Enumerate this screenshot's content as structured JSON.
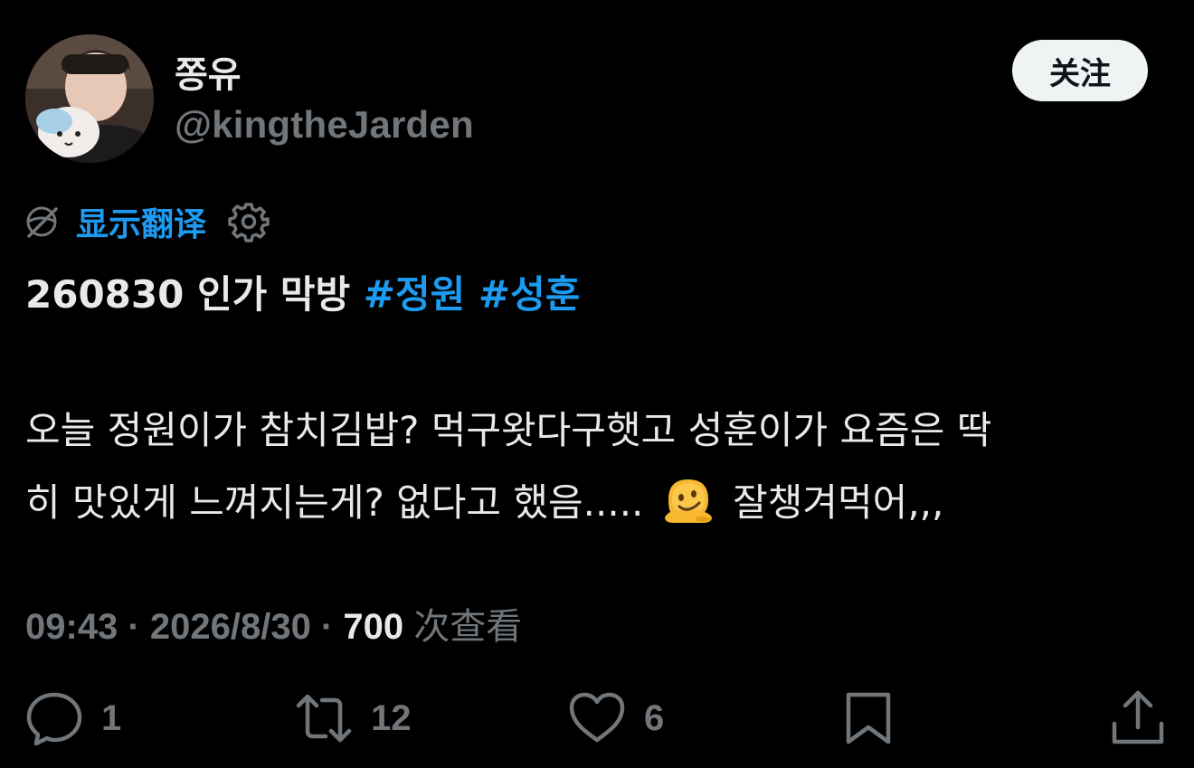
{
  "author": {
    "display_name": "쫑유",
    "handle": "@kingtheJarden"
  },
  "follow_button": {
    "label": "关注"
  },
  "translate": {
    "label": "显示翻译"
  },
  "tweet": {
    "line1_text": "260830 인가 막방 ",
    "hashtags": [
      "#정원",
      "#성훈"
    ],
    "body_line1": "오늘 정원이가 참치김밥? 먹구왓다구햇고 성훈이가 요즘은 딱",
    "body_line2_before_emoji": "히 맛있게 느껴지는게? 없다고 했음..... ",
    "body_line2_after_emoji": " 잘챙겨먹어,,,"
  },
  "meta": {
    "time": "09:43",
    "separator": " · ",
    "date": "2026/8/30",
    "views_count": "700",
    "views_label": "次查看"
  },
  "actions": {
    "reply_count": "1",
    "retweet_count": "12",
    "like_count": "6"
  },
  "colors": {
    "background": "#000000",
    "text_primary": "#e7e9ea",
    "text_secondary": "#71767b",
    "accent": "#1d9bf0",
    "follow_button_bg": "#eff3f4"
  },
  "icons": {
    "translate": "globe-slash-icon",
    "settings": "gear-icon",
    "emoji": "melting-face-emoji",
    "reply": "speech-bubble-icon",
    "retweet": "retweet-arrows-icon",
    "like": "heart-icon",
    "bookmark": "bookmark-icon",
    "share": "share-upload-icon"
  }
}
